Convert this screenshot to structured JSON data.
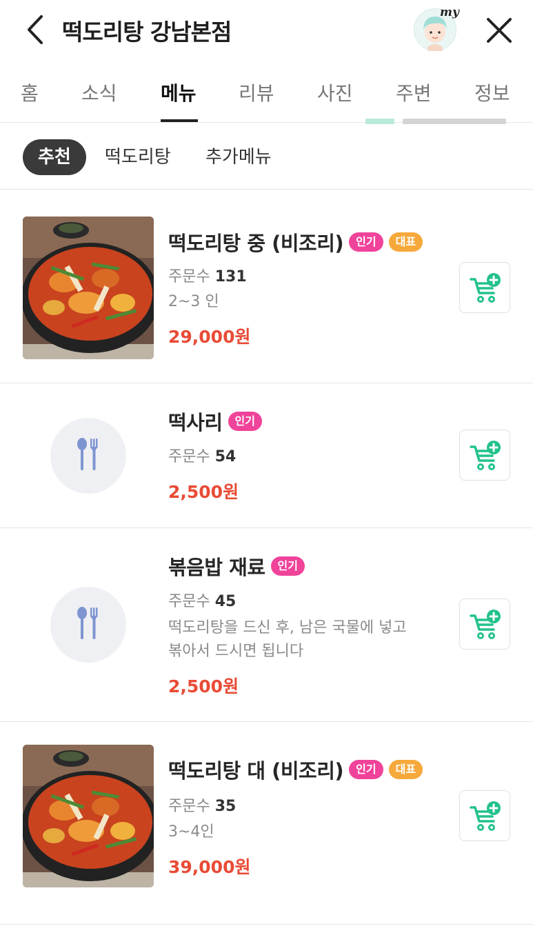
{
  "header": {
    "title": "떡도리탕 강남본점",
    "avatar_label": "my",
    "back_icon": "chevron-left-icon",
    "close_icon": "close-icon"
  },
  "tabs": [
    {
      "label": "홈"
    },
    {
      "label": "소식"
    },
    {
      "label": "메뉴",
      "active": true
    },
    {
      "label": "리뷰"
    },
    {
      "label": "사진"
    },
    {
      "label": "주변"
    },
    {
      "label": "정보"
    }
  ],
  "categories": [
    {
      "label": "추천",
      "active": true
    },
    {
      "label": "떡도리탕"
    },
    {
      "label": "추가메뉴"
    }
  ],
  "menu": {
    "orders_label": "주문수",
    "badge_popular": "인기",
    "badge_signature": "대표",
    "items": [
      {
        "name": "떡도리탕 중 (비조리)",
        "popular": true,
        "signature": true,
        "orders": "131",
        "desc": [
          "2~3 인"
        ],
        "price": "29,000원",
        "image": "spicy-braised-chicken-photo"
      },
      {
        "name": "떡사리",
        "popular": true,
        "signature": false,
        "orders": "54",
        "desc": [],
        "price": "2,500원",
        "image": "spoon-fork-placeholder-icon"
      },
      {
        "name": "볶음밥 재료",
        "popular": true,
        "signature": false,
        "orders": "45",
        "desc": [
          "떡도리탕을 드신 후, 남은 국물에 넣고",
          "볶아서 드시면 됩니다"
        ],
        "price": "2,500원",
        "image": "spoon-fork-placeholder-icon"
      },
      {
        "name": "떡도리탕 대 (비조리)",
        "popular": true,
        "signature": true,
        "orders": "35",
        "desc": [
          "3~4인"
        ],
        "price": "39,000원",
        "image": "spicy-braised-chicken-photo"
      }
    ]
  },
  "colors": {
    "price": "#e94b35",
    "badge_popular": "#f0439a",
    "badge_signature": "#f6a93b",
    "cart_icon": "#22c28a",
    "active_chip": "#3a3a3a"
  },
  "icons": {
    "cart": "cart-add-icon"
  }
}
